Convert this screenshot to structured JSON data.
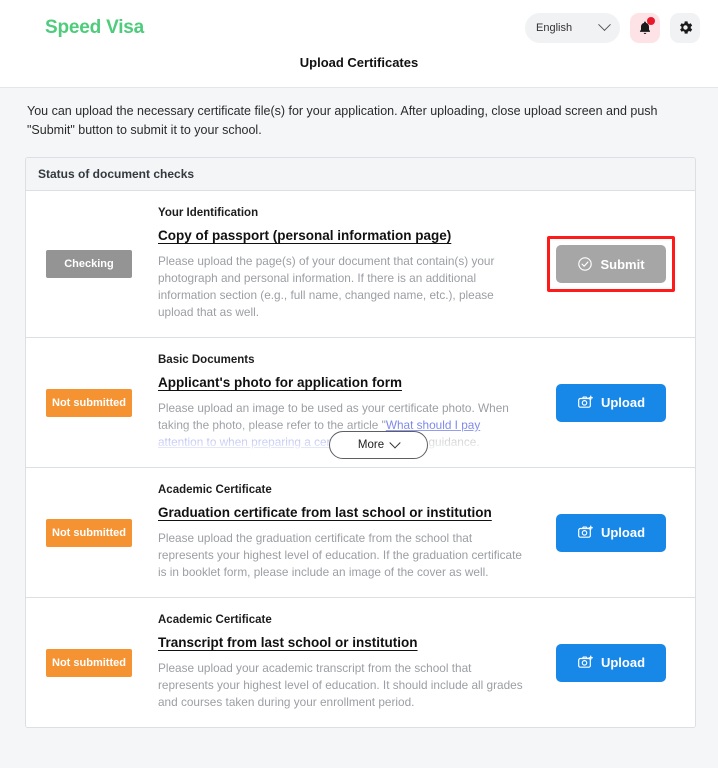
{
  "header": {
    "brand": "Speed Visa",
    "language": "English",
    "chevron_icon": "chevron-down-icon",
    "bell_icon": "bell-icon",
    "gear_icon": "gear-icon"
  },
  "page": {
    "title": "Upload Certificates",
    "intro": "You can upload the necessary certificate file(s) for your application. After uploading, close upload screen and push \"Submit\" button to submit it to your school."
  },
  "card": {
    "header": "Status of document checks"
  },
  "colors": {
    "brand_green": "#4ECB7B",
    "status_checking": "#949494",
    "status_not_submitted": "#f59333",
    "upload_blue": "#1787e8",
    "submit_gray": "#a6a6a6",
    "highlight_red": "#ff1a1a",
    "link_purple": "#7b86e8"
  },
  "more_button": {
    "label": "More",
    "chevron_icon": "chevron-down-icon"
  },
  "rows": [
    {
      "status": "Checking",
      "status_kind": "checking",
      "category": "Your Identification",
      "title": "Copy of passport (personal information page)",
      "description": "Please upload the page(s) of your document that contain(s) your photograph and personal information. If there is an additional information section (e.g., full name, changed name, etc.), please upload that as well.",
      "action_label": "Submit",
      "action_kind": "submit",
      "action_icon": "check-circle-icon",
      "highlighted": true,
      "clipped": false
    },
    {
      "status": "Not submitted",
      "status_kind": "not-submitted",
      "category": "Basic Documents",
      "title": "Applicant's photo for application form",
      "description_parts": [
        {
          "type": "text",
          "value": "Please upload an image to be used as your certificate photo. When taking the photo, please refer to the article \""
        },
        {
          "type": "link",
          "value": "What should I pay attention to when preparing a certificate photo?"
        },
        {
          "type": "text",
          "value": "\" for guidance."
        }
      ],
      "action_label": "Upload",
      "action_kind": "upload",
      "action_icon": "camera-plus-icon",
      "highlighted": false,
      "clipped": true
    },
    {
      "status": "Not submitted",
      "status_kind": "not-submitted",
      "category": "Academic Certificate",
      "title": "Graduation certificate from last school or institution",
      "description": "Please upload the graduation certificate from the school that represents your highest level of education. If the graduation certificate is in booklet form, please include an image of the cover as well.",
      "action_label": "Upload",
      "action_kind": "upload",
      "action_icon": "camera-plus-icon",
      "highlighted": false,
      "clipped": false
    },
    {
      "status": "Not submitted",
      "status_kind": "not-submitted",
      "category": "Academic Certificate",
      "title": "Transcript from last school or institution",
      "description": "Please upload your academic transcript from the school that represents your highest level of education. It should include all grades and courses taken during your enrollment period.",
      "action_label": "Upload",
      "action_kind": "upload",
      "action_icon": "camera-plus-icon",
      "highlighted": false,
      "clipped": false
    }
  ]
}
